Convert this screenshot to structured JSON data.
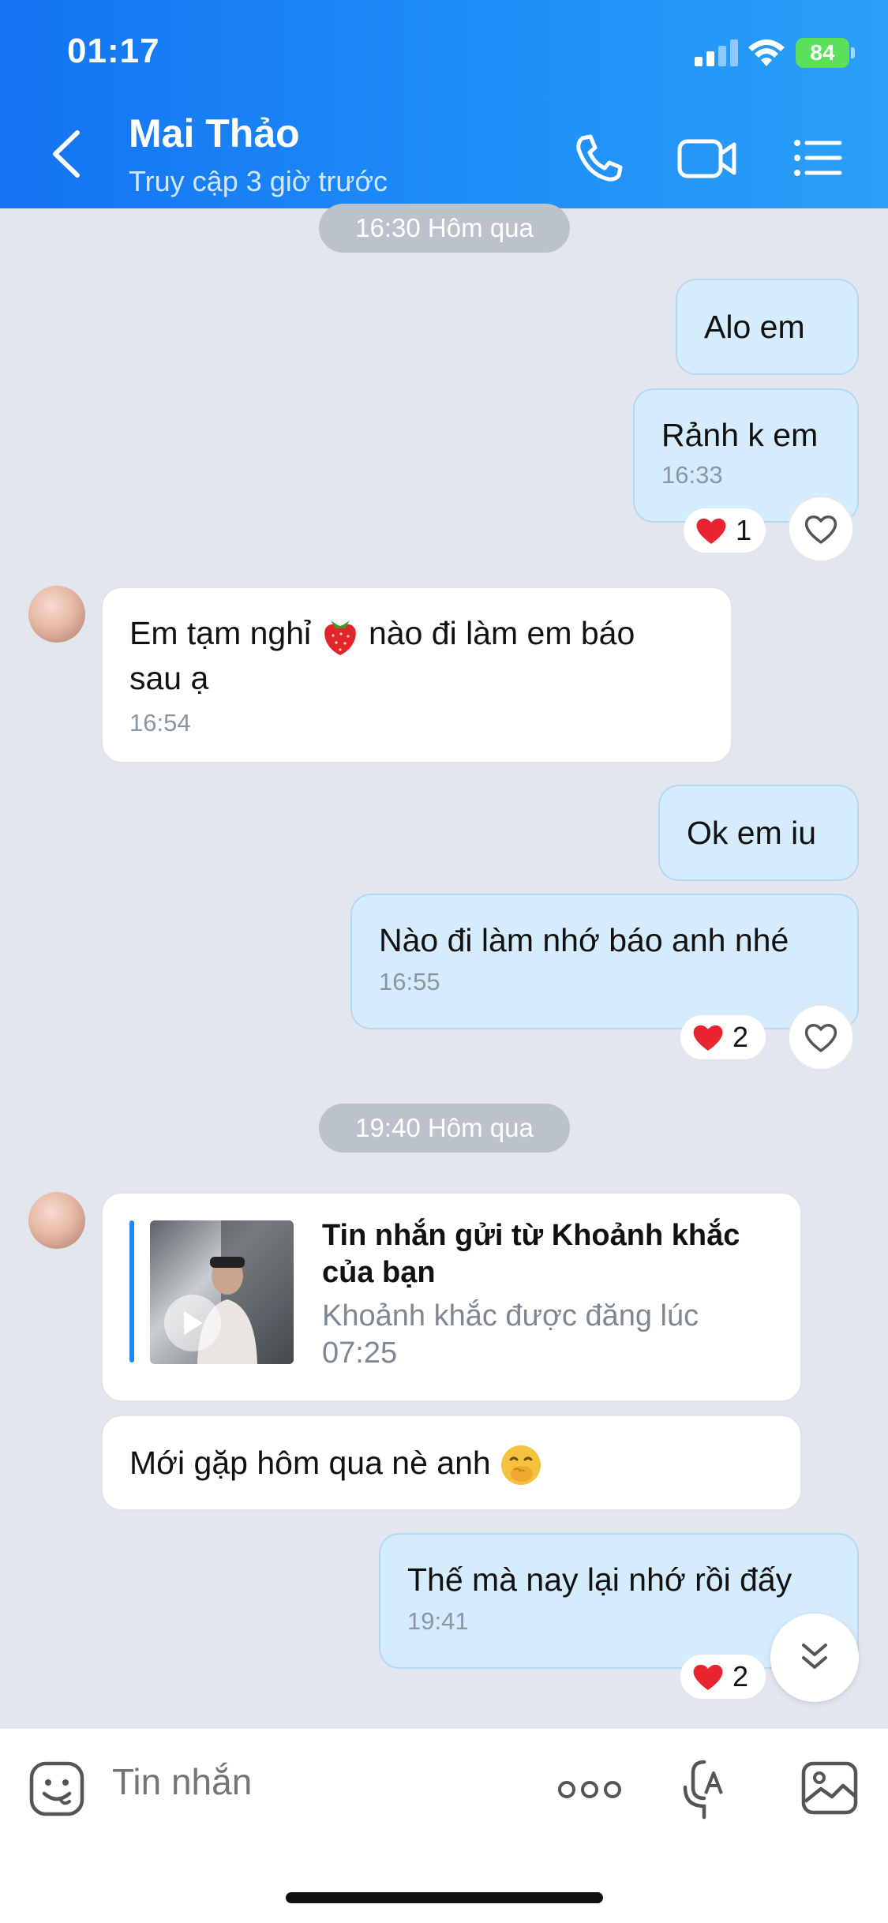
{
  "status_bar": {
    "time": "01:17",
    "battery": "84"
  },
  "header": {
    "contact_name": "Mai Thảo",
    "contact_status": "Truy cập 3 giờ trước"
  },
  "separators": [
    "16:30 Hôm qua",
    "19:40 Hôm qua"
  ],
  "messages": [
    {
      "from": "me",
      "text": "Alo em"
    },
    {
      "from": "me",
      "text": "Rảnh k em",
      "time": "16:33",
      "reaction_count": "1"
    },
    {
      "from": "them",
      "text_before": "Em tạm nghỉ",
      "text_after": "nào đi làm em báo",
      "text_line2": "sau ạ",
      "emoji": "strawberry",
      "time": "16:54"
    },
    {
      "from": "me",
      "text": "Ok em iu"
    },
    {
      "from": "me",
      "text": "Nào đi làm nhớ báo anh nhé",
      "time": "16:55",
      "reaction_count": "2"
    },
    {
      "from": "them",
      "type": "moment-share",
      "title": "Tin nhắn gửi từ Khoảnh khắc của bạn",
      "subtitle": "Khoảnh khắc được đăng lúc 07:25"
    },
    {
      "from": "them",
      "text": "Mới gặp hôm qua nè anh",
      "emoji": "face-with-hand-over-mouth"
    },
    {
      "from": "me",
      "text": "Thế mà nay lại nhớ rồi đấy",
      "time": "19:41",
      "reaction_count": "2"
    }
  ],
  "input": {
    "placeholder": "Tin nhắn"
  },
  "colors": {
    "header": "#1e8ef8",
    "my_bubble": "#d5ecfd",
    "their_bubble": "#ffffff",
    "background": "#e2e7ef",
    "heart": "#e8242f"
  }
}
